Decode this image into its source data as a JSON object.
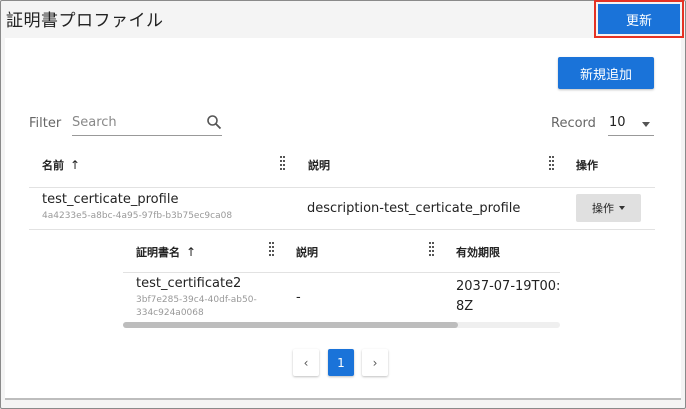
{
  "header": {
    "title": "証明書プロファイル",
    "refresh_label": "更新",
    "refresh_color": "#1a73d9",
    "highlight_color": "#e53224"
  },
  "toolbar": {
    "add_label": "新規追加",
    "filter_label": "Filter",
    "search_placeholder": "Search",
    "record_label": "Record",
    "record_value": "10"
  },
  "table": {
    "columns": [
      "名前",
      "説明",
      "操作"
    ],
    "rows": [
      {
        "name": "test_certicate_profile",
        "id": "4a4233e5-a8bc-4a95-97fb-b3b75ec9ca08",
        "description": "description-test_certicate_profile",
        "action_label": "操作"
      }
    ]
  },
  "subtable": {
    "columns": [
      "証明書名",
      "説明",
      "有効期限"
    ],
    "rows": [
      {
        "name": "test_certificate2",
        "id_line1": "3bf7e285-39c4-40df-ab50-",
        "id_line2": "334c924a0068",
        "description": "-",
        "expiry_line1": "2037-07-19T00:",
        "expiry_line2": "8Z"
      }
    ]
  },
  "pagination": {
    "prev": "‹",
    "current": "1",
    "next": "›"
  }
}
